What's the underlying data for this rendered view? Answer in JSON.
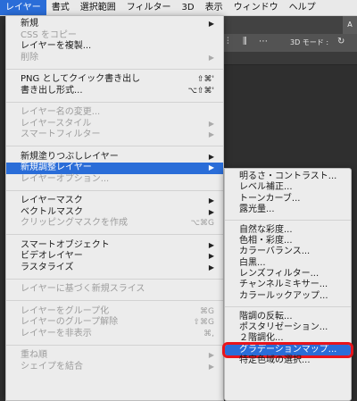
{
  "menubar": {
    "items": [
      "レイヤー",
      "書式",
      "選択範囲",
      "フィルター",
      "3D",
      "表示",
      "ウィンドウ",
      "ヘルプ"
    ],
    "active_index": 0
  },
  "app": {
    "mode_label": "3D モード :",
    "edge_tab": "A"
  },
  "layer_menu": [
    {
      "label": "新規",
      "arrow": true
    },
    {
      "label": "CSS をコピー",
      "disabled": true
    },
    {
      "label": "レイヤーを複製..."
    },
    {
      "label": "削除",
      "disabled": true,
      "arrow": true
    },
    {
      "sep": true
    },
    {
      "label": "PNG としてクイック書き出し",
      "shortcut": "⇧⌘'"
    },
    {
      "label": "書き出し形式...",
      "shortcut": "⌥⇧⌘'"
    },
    {
      "sep": true
    },
    {
      "label": "レイヤー名の変更...",
      "disabled": true
    },
    {
      "label": "レイヤースタイル",
      "disabled": true,
      "arrow": true
    },
    {
      "label": "スマートフィルター",
      "disabled": true,
      "arrow": true
    },
    {
      "sep": true
    },
    {
      "label": "新規塗りつぶしレイヤー",
      "arrow": true
    },
    {
      "label": "新規調整レイヤー",
      "arrow": true,
      "highlighted": true
    },
    {
      "label": "レイヤーオプション...",
      "disabled": true
    },
    {
      "sep": true
    },
    {
      "label": "レイヤーマスク",
      "arrow": true
    },
    {
      "label": "ベクトルマスク",
      "arrow": true
    },
    {
      "label": "クリッピングマスクを作成",
      "disabled": true,
      "shortcut": "⌥⌘G"
    },
    {
      "sep": true
    },
    {
      "label": "スマートオブジェクト",
      "arrow": true
    },
    {
      "label": "ビデオレイヤー",
      "arrow": true
    },
    {
      "label": "ラスタライズ",
      "arrow": true
    },
    {
      "sep": true
    },
    {
      "label": "レイヤーに基づく新規スライス",
      "disabled": true
    },
    {
      "sep": true
    },
    {
      "label": "レイヤーをグループ化",
      "disabled": true,
      "shortcut": "⌘G"
    },
    {
      "label": "レイヤーのグループ解除",
      "disabled": true,
      "shortcut": "⇧⌘G"
    },
    {
      "label": "レイヤーを非表示",
      "disabled": true,
      "shortcut": "⌘,"
    },
    {
      "sep": true
    },
    {
      "label": "重ね順",
      "disabled": true,
      "arrow": true
    },
    {
      "label": "シェイプを結合",
      "disabled": true,
      "arrow": true
    }
  ],
  "adjustment_submenu": [
    {
      "label": "明るさ・コントラスト..."
    },
    {
      "label": "レベル補正..."
    },
    {
      "label": "トーンカーブ..."
    },
    {
      "label": "露光量..."
    },
    {
      "sep": true
    },
    {
      "label": "自然な彩度..."
    },
    {
      "label": "色相・彩度..."
    },
    {
      "label": "カラーバランス..."
    },
    {
      "label": "白黒..."
    },
    {
      "label": "レンズフィルター..."
    },
    {
      "label": "チャンネルミキサー..."
    },
    {
      "label": "カラールックアップ..."
    },
    {
      "sep": true
    },
    {
      "label": "階調の反転..."
    },
    {
      "label": "ポスタリゼーション..."
    },
    {
      "label": "２階調化..."
    },
    {
      "label": "グラデーションマップ...",
      "highlighted": true,
      "boxed": true
    },
    {
      "label": "特定色域の選択..."
    }
  ],
  "colors": {
    "highlight": "#2a6dd8",
    "callout_border": "#e8141b"
  }
}
